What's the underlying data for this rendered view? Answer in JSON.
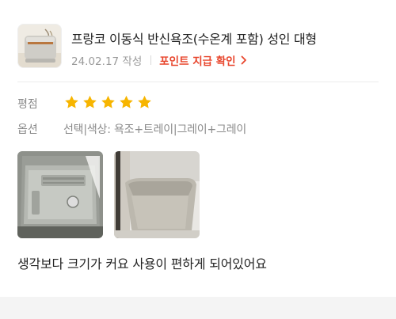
{
  "product": {
    "title": "프랑코 이동식 반신욕조(수온계 포함) 성인 대형",
    "date": "24.02.17 작성",
    "points_link": "포인트 지급 확인",
    "points_arrow_icon": "chevron-right-icon"
  },
  "rating": {
    "label": "평점",
    "stars": 5,
    "max_stars": 5,
    "star_color": "#f7b500"
  },
  "option": {
    "label": "옵션",
    "value": "선택|색상: 욕조+트레이|그레이+그레이"
  },
  "review": {
    "text": "생각보다 크기가 커요 사용이 편하게 되어있어요"
  },
  "colors": {
    "accent": "#e8452c",
    "muted_text": "#8a8a8a"
  }
}
